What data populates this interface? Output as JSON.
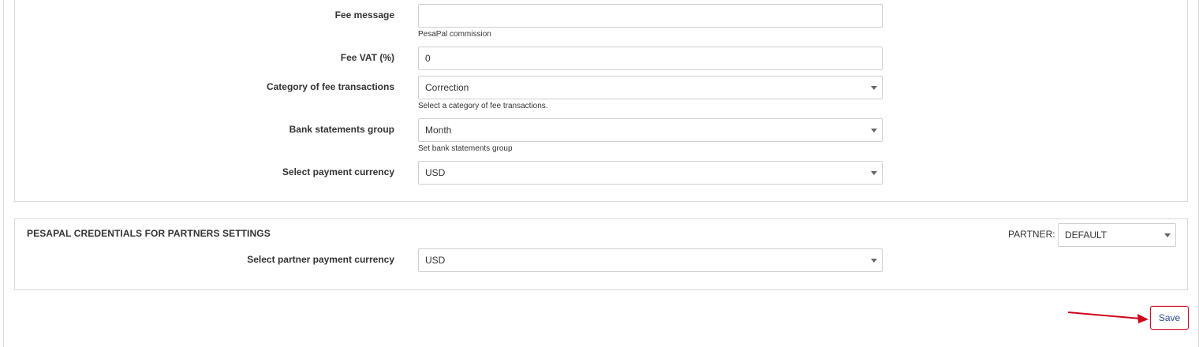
{
  "form": {
    "fee_message": {
      "label": "Fee message",
      "value": "",
      "help": "PesaPal commission"
    },
    "fee_vat": {
      "label": "Fee VAT (%)",
      "value": "0"
    },
    "fee_category": {
      "label": "Category of fee transactions",
      "value": "Correction",
      "help": "Select a category of fee transactions."
    },
    "bank_statements_group": {
      "label": "Bank statements group",
      "value": "Month",
      "help": "Set bank statements group"
    },
    "payment_currency": {
      "label": "Select payment currency",
      "value": "USD"
    }
  },
  "partners_section": {
    "title": "PESAPAL CREDENTIALS FOR PARTNERS SETTINGS",
    "partner_label": "PARTNER:",
    "partner_value": "DEFAULT",
    "partner_currency": {
      "label": "Select partner payment currency",
      "value": "USD"
    }
  },
  "actions": {
    "save_label": "Save"
  },
  "colors": {
    "annotation_arrow": "#d0021b",
    "save_border": "#c8102e",
    "save_text": "#2a4d8f"
  },
  "icons": {
    "select_caret": "caret-down-icon",
    "annotation": "arrow-right-icon"
  }
}
